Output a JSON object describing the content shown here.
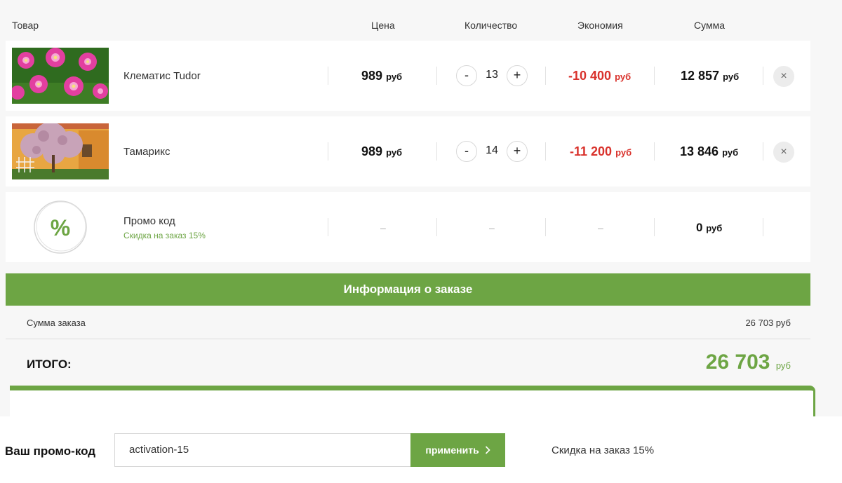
{
  "columns": {
    "product": "Товар",
    "price": "Цена",
    "quantity": "Количество",
    "savings": "Экономия",
    "sum": "Сумма"
  },
  "currency": "руб",
  "items": [
    {
      "name": "Клематис Tudor",
      "price": "989",
      "quantity": "13",
      "savings": "-10 400",
      "sum": "12 857",
      "image": "clematis-flower-photo"
    },
    {
      "name": "Тамарикс",
      "price": "989",
      "quantity": "14",
      "savings": "-11 200",
      "sum": "13 846",
      "image": "tamarix-tree-photo"
    }
  ],
  "promo_row": {
    "name": "Промо код",
    "subtitle": "Скидка на заказ 15%",
    "dash": "–",
    "sum": "0",
    "icon": "percent-icon"
  },
  "qty_buttons": {
    "minus": "-",
    "plus": "+"
  },
  "remove_symbol": "×",
  "order_info": {
    "title": "Информация о заказе",
    "sum_label": "Сумма заказа",
    "sum_value": "26 703 руб",
    "total_label": "ИТОГО:",
    "total_value": "26 703",
    "total_currency": "руб"
  },
  "promo_form": {
    "label": "Ваш промо-код",
    "value": "activation-15",
    "apply_label": "применить",
    "result": "Скидка на заказ 15%"
  },
  "colors": {
    "accent": "#6da544",
    "danger": "#d9322c",
    "background": "#f7f7f7"
  }
}
